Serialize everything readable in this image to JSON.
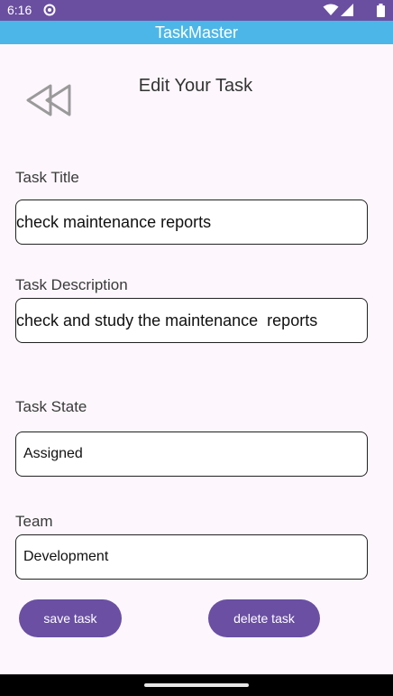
{
  "status_bar": {
    "time": "6:16",
    "background": "#6a4fa0",
    "icons": [
      "sync-icon",
      "wifi-icon",
      "signal-icon",
      "battery-icon"
    ]
  },
  "app_bar": {
    "title": "TaskMaster",
    "background": "#4db6e8"
  },
  "header": {
    "back_icon": "rewind-back-icon",
    "title": "Edit Your Task"
  },
  "form": {
    "task_title": {
      "label": "Task Title",
      "value": "check maintenance reports"
    },
    "task_description": {
      "label": "Task Description",
      "value": "check and study the maintenance  reports"
    },
    "task_state": {
      "label": "Task State",
      "value": "Assigned"
    },
    "team": {
      "label": "Team",
      "value": "Development"
    }
  },
  "actions": {
    "save_label": "save task",
    "delete_label": "delete task",
    "button_color": "#6a4fa3"
  }
}
